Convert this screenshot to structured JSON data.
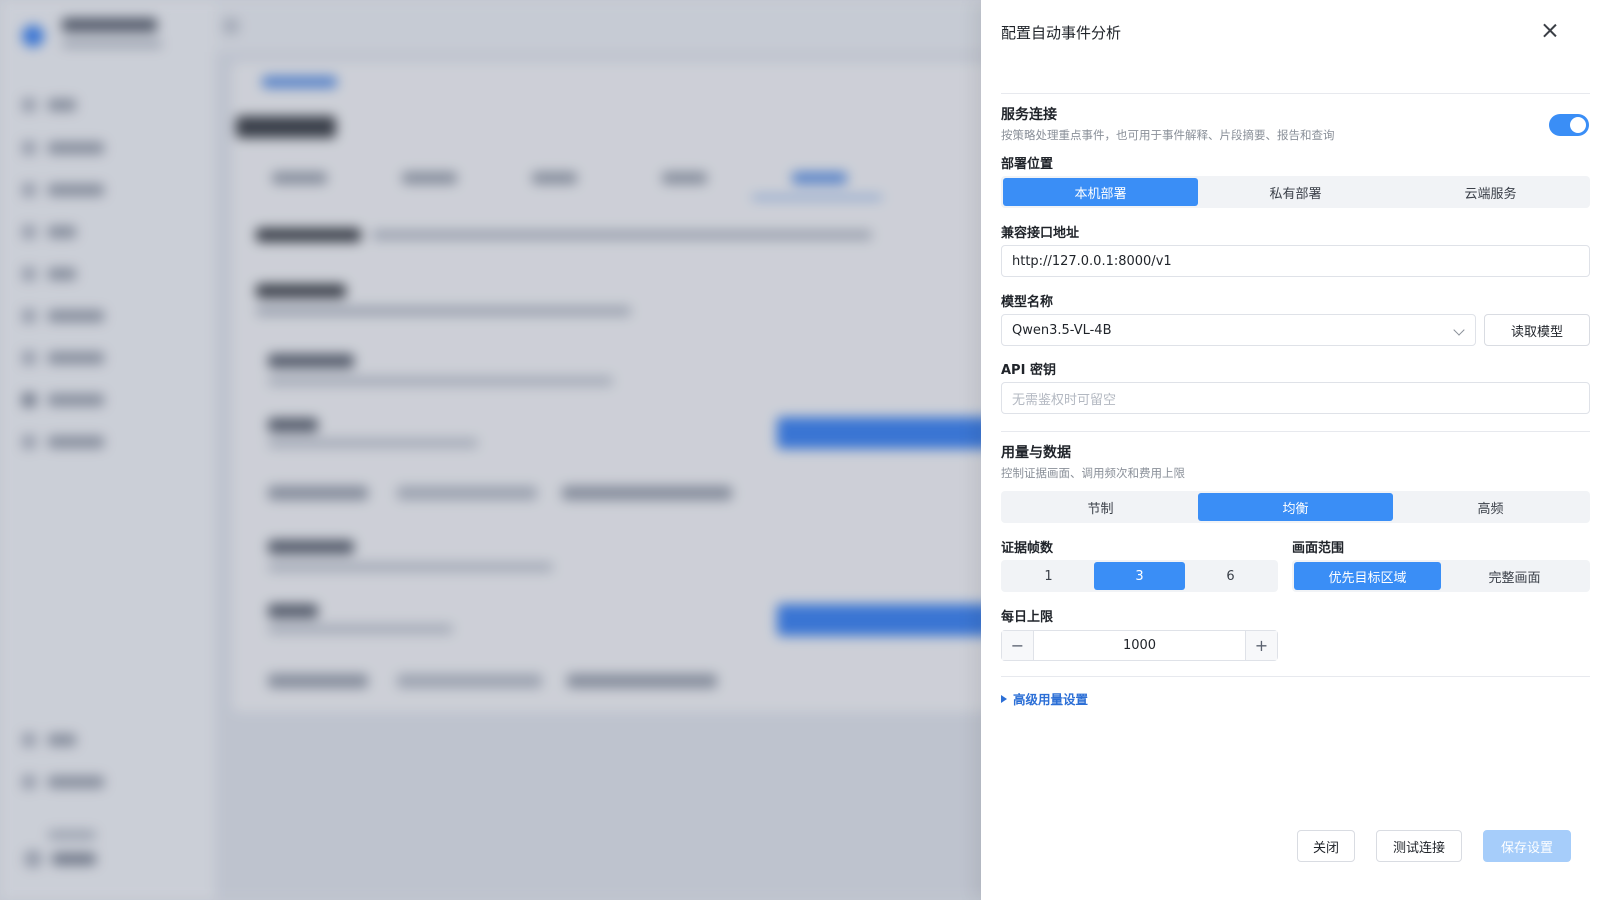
{
  "drawer": {
    "title": "配置自动事件分析",
    "service": {
      "title": "服务连接",
      "description": "按策略处理重点事件，也可用于事件解释、片段摘要、报告和查询",
      "enabled": true
    },
    "deployment": {
      "label": "部署位置",
      "options": [
        "本机部署",
        "私有部署",
        "云端服务"
      ],
      "selected": "本机部署"
    },
    "endpoint": {
      "label": "兼容接口地址",
      "value": "http://127.0.0.1:8000/v1"
    },
    "model": {
      "label": "模型名称",
      "value": "Qwen3.5-VL-4B",
      "fetch_button": "读取模型"
    },
    "api_key": {
      "label": "API 密钥",
      "placeholder": "无需鉴权时可留空"
    },
    "usage": {
      "title": "用量与数据",
      "description": "控制证据画面、调用频次和费用上限",
      "modes": [
        "节制",
        "均衡",
        "高频"
      ],
      "selected_mode": "均衡"
    },
    "evidence_frames": {
      "label": "证据帧数",
      "options": [
        "1",
        "3",
        "6"
      ],
      "selected": "3"
    },
    "frame_scope": {
      "label": "画面范围",
      "options": [
        "优先目标区域",
        "完整画面"
      ],
      "selected": "优先目标区域"
    },
    "daily_limit": {
      "label": "每日上限",
      "value": "1000",
      "minus": "−",
      "plus": "+"
    },
    "advanced": {
      "label": "高级用量设置"
    },
    "footer": {
      "close": "关闭",
      "test": "测试连接",
      "save": "保存设置"
    }
  },
  "colors": {
    "accent": "#3a8ef6",
    "link": "#2c6fd6",
    "save_disabled": "#a6cdfa"
  }
}
